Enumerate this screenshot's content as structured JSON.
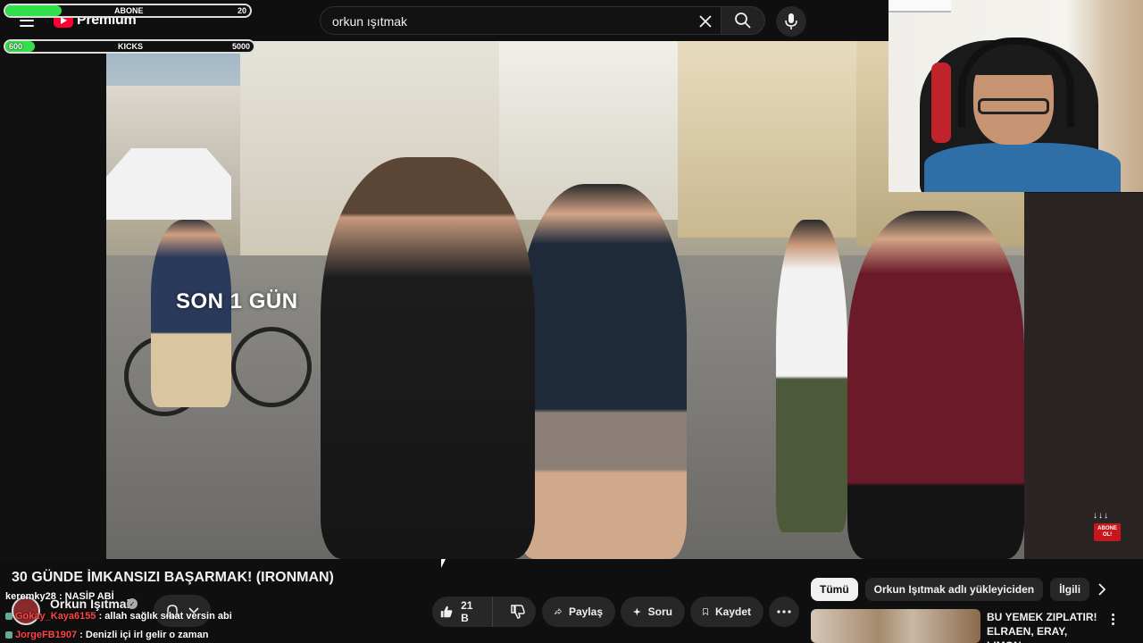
{
  "header": {
    "logo_text": "Premium",
    "search_value": "orkun ışıtmak"
  },
  "overlay": {
    "subs_label": "ABONE",
    "subs_value": "20",
    "subs_progress": 0.23,
    "kicks_label": "KICKS",
    "kicks_current": "600",
    "kicks_max": "5000",
    "kicks_progress": 0.12,
    "abone_badge_line1": "ABONE",
    "abone_badge_line2": "OL!"
  },
  "video": {
    "caption": "SON 1 GÜN",
    "title": "30 GÜNDE İMKANSIZI BAŞARMAK! (IRONMAN)"
  },
  "channel": {
    "name": "Orkun Işıtmak"
  },
  "chat": [
    {
      "user": "keremky28",
      "sep": " : ",
      "text": "NASİP ABİ"
    },
    {
      "user": "Gokay_Kaya6155",
      "sep": " : ",
      "text": "allah sağlık sıhat versin abi"
    },
    {
      "user": "JorgeFB1907",
      "sep": " : ",
      "text": "Denizli içi irl gelir o zaman"
    }
  ],
  "actions": {
    "like_count": "21 B",
    "share": "Paylaş",
    "ask": "Soru",
    "save": "Kaydet"
  },
  "chips": [
    {
      "label": "Tümü",
      "active": true
    },
    {
      "label": "Orkun Işıtmak adlı yükleyiciden",
      "active": false
    },
    {
      "label": "İlgili",
      "active": false
    }
  ],
  "recommendation": {
    "title": "BU YEMEK ZIPLATIR! ELRAEN, ERAY, LIMON,..."
  },
  "colors": {
    "background": "#0f0f0f",
    "brand_red": "#ff0033",
    "progress_green": "#33e04b",
    "chat_user_red": "#ff4545"
  }
}
